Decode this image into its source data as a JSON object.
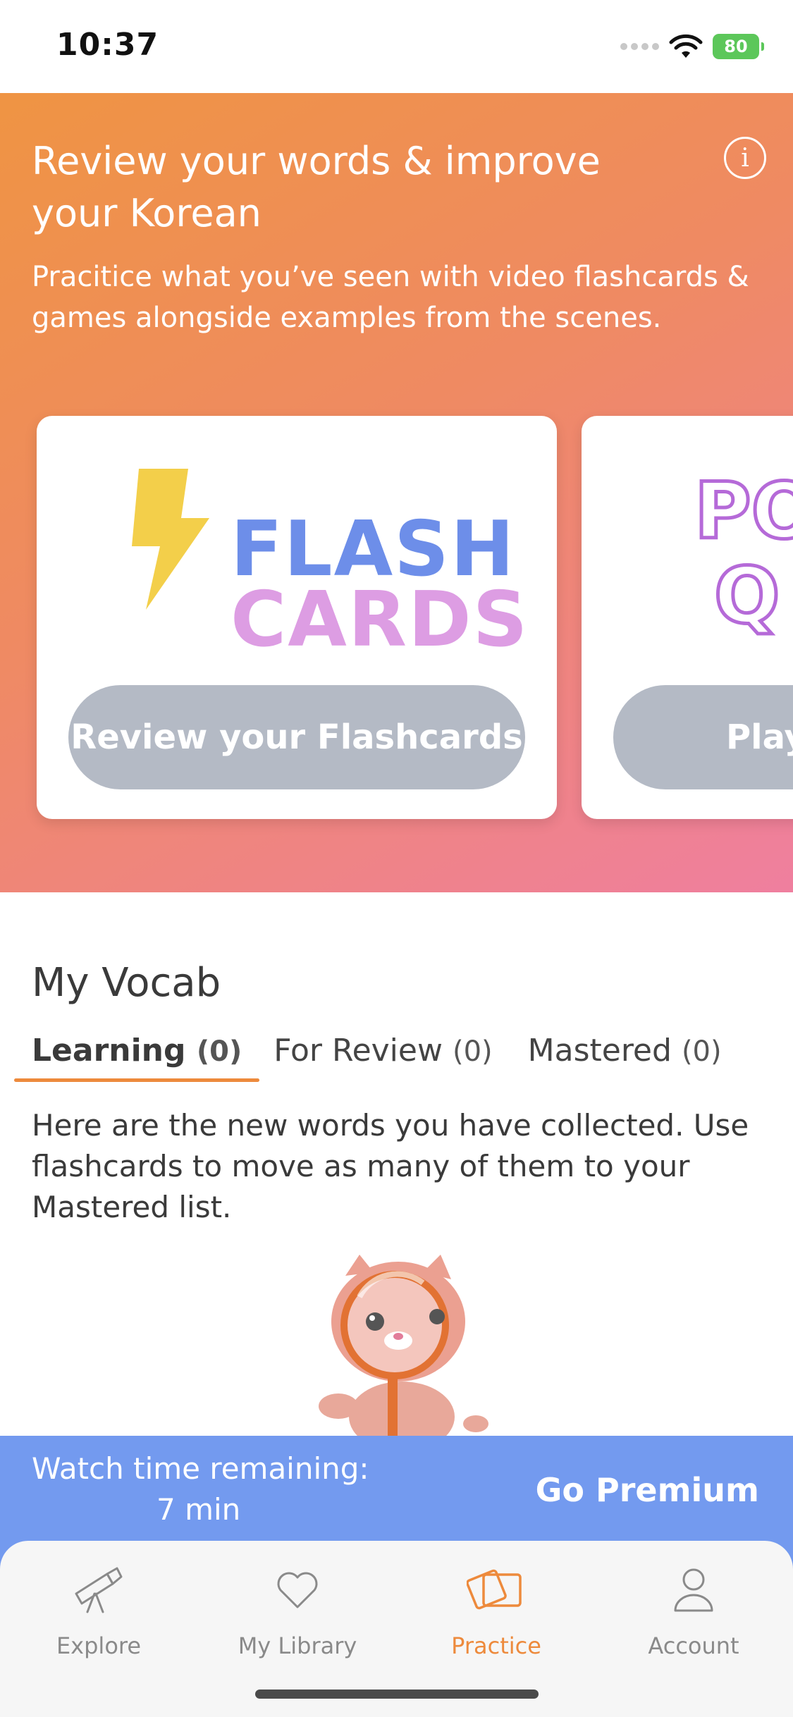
{
  "status_bar": {
    "time": "10:37",
    "battery": "80"
  },
  "hero": {
    "title": "Review your words & improve your Korean",
    "subtitle": "Pracitice what you’ve seen with video flashcards & games alongside examples from the scenes.",
    "info_icon": "info-icon",
    "cards": [
      {
        "logo_line1": "FLASH",
        "logo_line2": "CARDS",
        "button_label": "Review your Flashcards"
      },
      {
        "logo_line1": "PO",
        "logo_line2": "Q",
        "button_label": "Play"
      }
    ]
  },
  "vocab": {
    "title": "My Vocab",
    "tabs": [
      {
        "label": "Learning",
        "count": "(0)"
      },
      {
        "label": "For Review",
        "count": "(0)"
      },
      {
        "label": "Mastered",
        "count": "(0)"
      }
    ],
    "description": "Here are the new words you have collected. Use flashcards to move as many of them to your Mastered list."
  },
  "premium": {
    "label": "Watch time remaining:",
    "time": "7 min",
    "button": "Go Premium"
  },
  "nav": {
    "items": [
      {
        "label": "Explore",
        "icon": "telescope-icon"
      },
      {
        "label": "My Library",
        "icon": "heart-icon"
      },
      {
        "label": "Practice",
        "icon": "cards-icon"
      },
      {
        "label": "Account",
        "icon": "user-icon"
      }
    ],
    "active_color": "#ed8a3c",
    "inactive_color": "#8a8a8a"
  },
  "colors": {
    "accent": "#ed8a3c",
    "premium_blue": "#739aef",
    "button_gray": "#b4bac5"
  }
}
